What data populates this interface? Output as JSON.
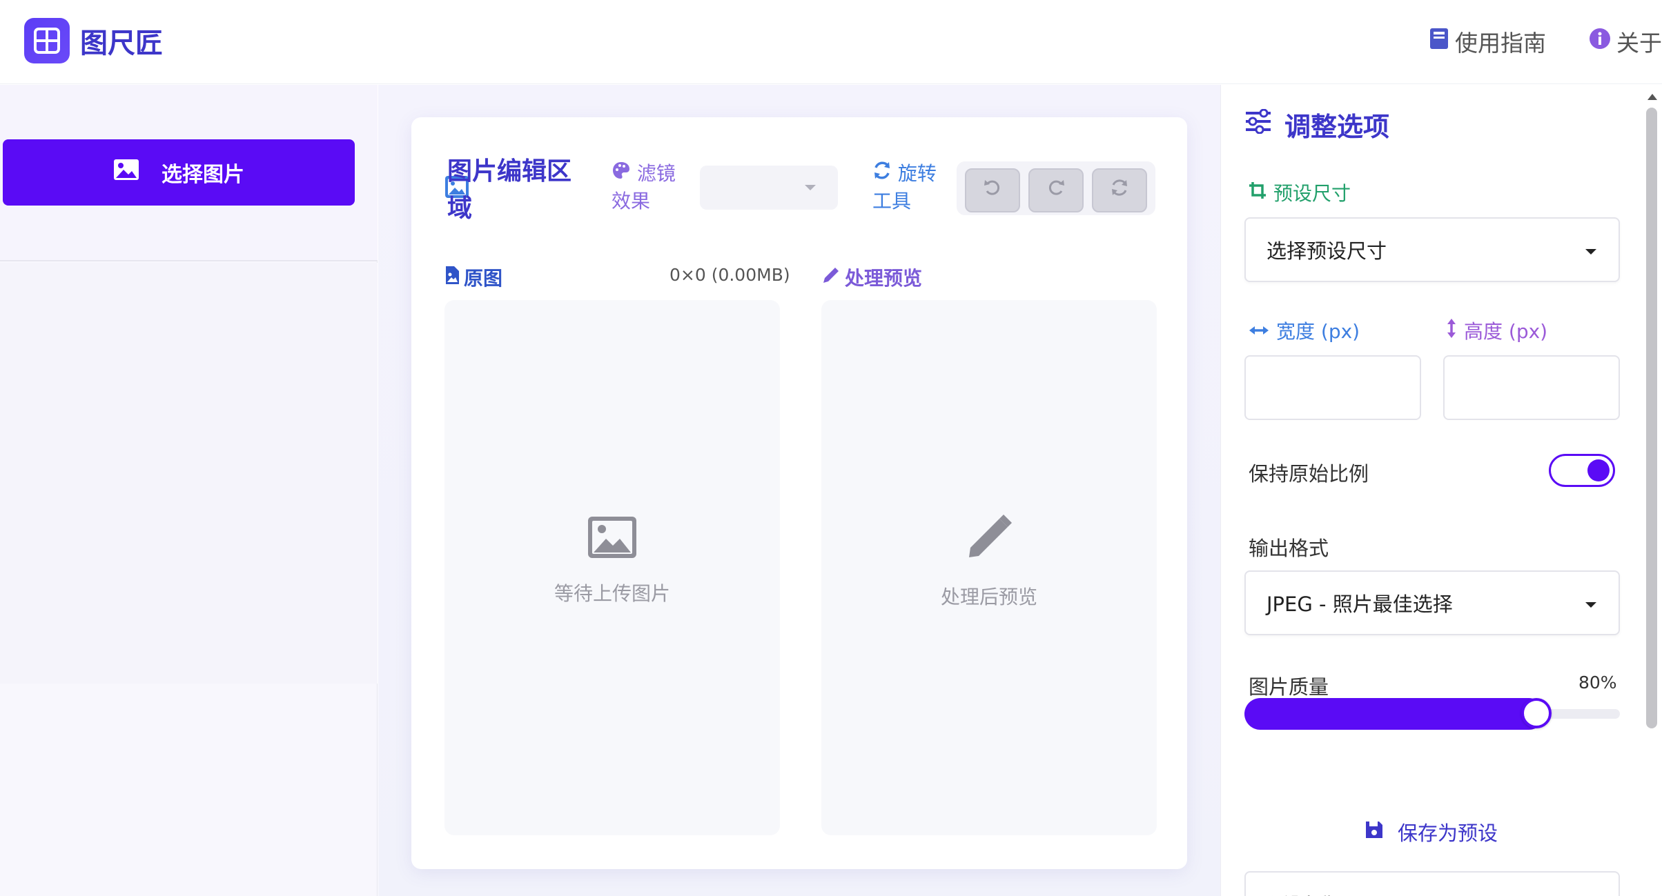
{
  "header": {
    "app_name": "图尺匠",
    "nav_guide": "使用指南",
    "nav_about": "关于"
  },
  "sidebar": {
    "select_image_label": "选择图片"
  },
  "editor": {
    "title": "图片编辑区域",
    "filter_label": "滤镜效果",
    "filter_value": "",
    "rotate_label": "旋转工具",
    "original_label": "原图",
    "original_size": "0×0 (0.00MB)",
    "preview_label": "处理预览",
    "original_placeholder": "等待上传图片",
    "preview_placeholder": "处理后预览"
  },
  "options": {
    "title": "调整选项",
    "preset_label": "预设尺寸",
    "preset_value": "选择预设尺寸",
    "width_label": "宽度 (px)",
    "height_label": "高度 (px)",
    "width_value": "",
    "height_value": "",
    "keep_ratio_label": "保持原始比例",
    "keep_ratio_on": true,
    "format_label": "输出格式",
    "format_value": "JPEG - 照片最佳选择",
    "quality_label": "图片质量",
    "quality_value": "80%",
    "quality_fraction": 0.8,
    "save_preset_label": "保存为预设",
    "bottom_input_placeholder": "预设名称"
  },
  "colors": {
    "accent": "#5a0bf5",
    "brand": "#3d36c9",
    "filter": "#8a6ae0",
    "rotate": "#3d7ee0",
    "preset_green": "#22a06b",
    "width_blue": "#3d7ee0",
    "height_purple": "#9b5ad8"
  }
}
